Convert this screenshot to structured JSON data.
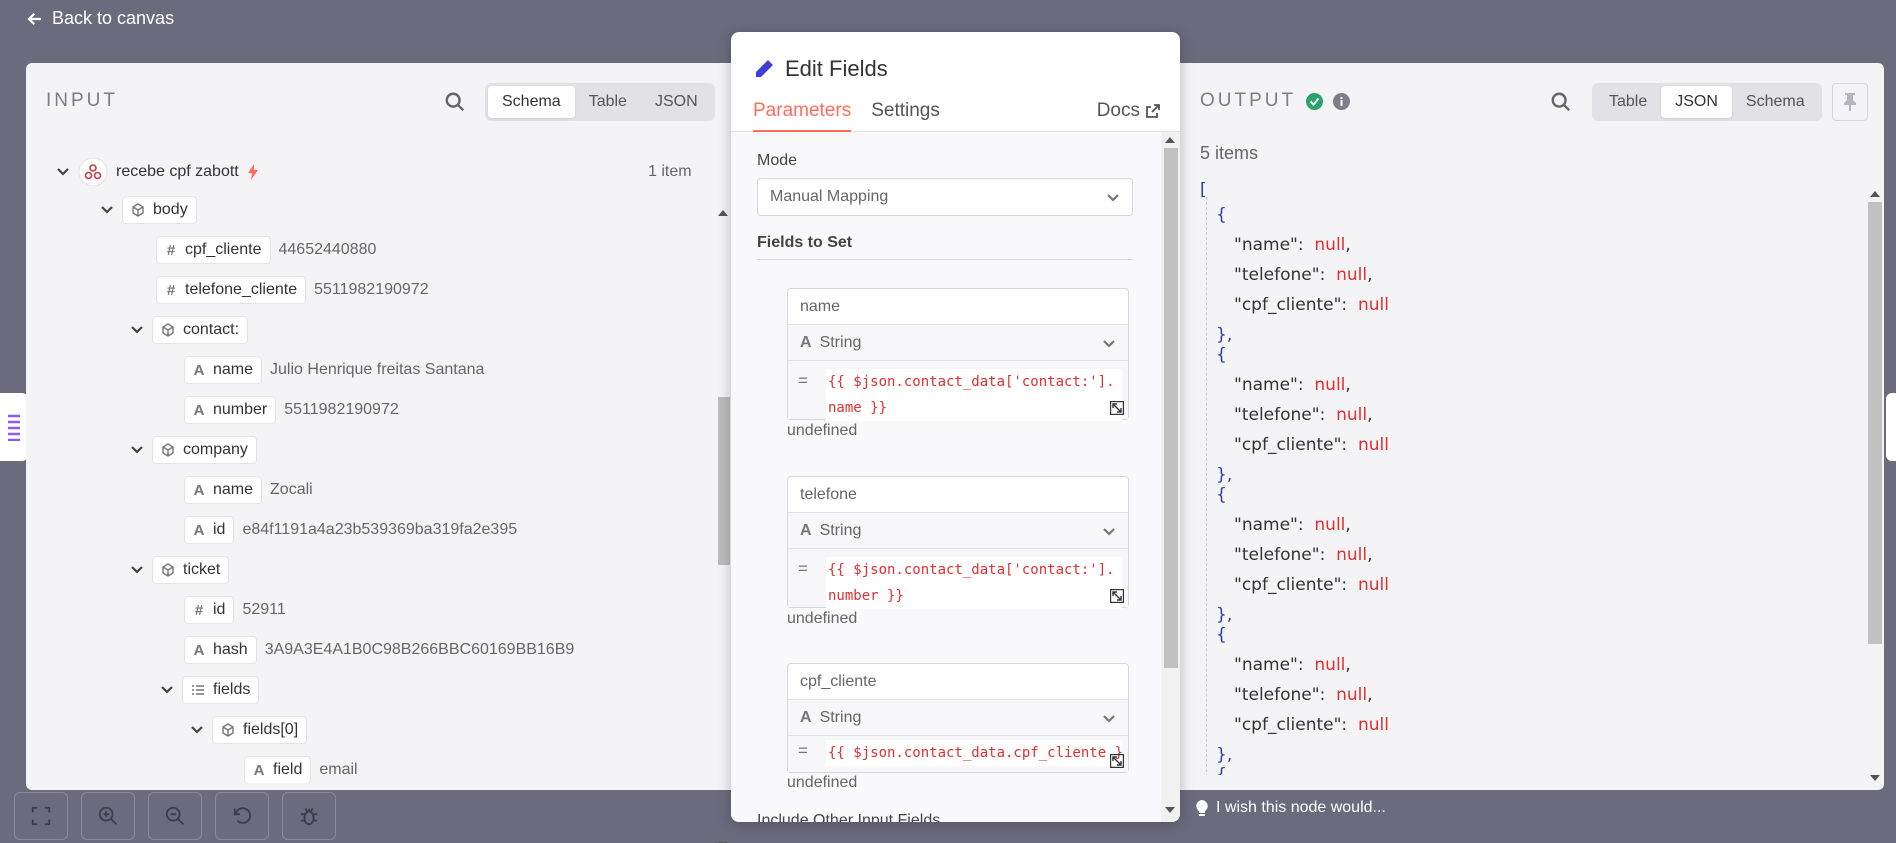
{
  "back_label": "Back to canvas",
  "input": {
    "title": "INPUT",
    "tabs": [
      "Schema",
      "Table",
      "JSON"
    ],
    "active_tab": "Schema",
    "node_name": "recebe cpf zabott",
    "item_count": "1 item",
    "tree": [
      {
        "key": "body",
        "type": "object",
        "value": ""
      },
      {
        "key": "cpf_cliente",
        "type": "#",
        "value": "44652440880"
      },
      {
        "key": "telefone_cliente",
        "type": "#",
        "value": "5511982190972"
      },
      {
        "key": "contact:",
        "type": "object",
        "value": ""
      },
      {
        "key": "name",
        "type": "A",
        "value": "Julio Henrique freitas Santana"
      },
      {
        "key": "number",
        "type": "A",
        "value": "5511982190972"
      },
      {
        "key": "company",
        "type": "object",
        "value": ""
      },
      {
        "key": "name",
        "type": "A",
        "value": "Zocali"
      },
      {
        "key": "id",
        "type": "A",
        "value": "e84f1191a4a23b539369ba319fa2e395"
      },
      {
        "key": "ticket",
        "type": "object",
        "value": ""
      },
      {
        "key": "id",
        "type": "#",
        "value": "52911"
      },
      {
        "key": "hash",
        "type": "A",
        "value": "3A9A3E4A1B0C98B266BBC60169BB16B9"
      },
      {
        "key": "fields",
        "type": "list",
        "value": ""
      },
      {
        "key": "fields[0]",
        "type": "object",
        "value": ""
      },
      {
        "key": "field",
        "type": "A",
        "value": "email"
      }
    ]
  },
  "modal": {
    "title": "Edit Fields",
    "tabs": [
      "Parameters",
      "Settings"
    ],
    "docs": "Docs",
    "mode_label": "Mode",
    "mode_value": "Manual Mapping",
    "fields_section": "Fields to Set",
    "fields": [
      {
        "name": "name",
        "type": "String",
        "expr": "{{ $json.contact_data['contact:'].name }}",
        "result": "undefined"
      },
      {
        "name": "telefone",
        "type": "String",
        "expr": "{{ $json.contact_data['contact:'].number }}",
        "result": "undefined"
      },
      {
        "name": "cpf_cliente",
        "type": "String",
        "expr": "{{ $json.contact_data.cpf_cliente }}",
        "result": "undefined"
      }
    ],
    "include_label": "Include Other Input Fields"
  },
  "output": {
    "title": "OUTPUT",
    "tabs": [
      "Table",
      "JSON",
      "Schema"
    ],
    "active_tab": "JSON",
    "items_count": "5 items",
    "items": [
      {
        "name": "null",
        "telefone": "null",
        "cpf_cliente": "null"
      },
      {
        "name": "null",
        "telefone": "null",
        "cpf_cliente": "null"
      },
      {
        "name": "null",
        "telefone": "null",
        "cpf_cliente": "null"
      },
      {
        "name": "null",
        "telefone": "null",
        "cpf_cliente": "null"
      }
    ]
  },
  "wish_label": "I wish this node would..."
}
